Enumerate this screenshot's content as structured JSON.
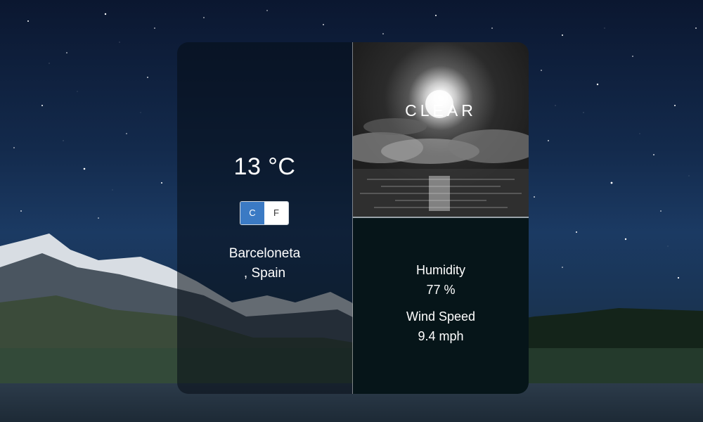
{
  "weather": {
    "temperature": "13 °C",
    "units": {
      "celsius_label": "C",
      "fahrenheit_label": "F",
      "selected": "C"
    },
    "location_city": "Barceloneta",
    "location_country": ", Spain",
    "condition": "CLEAR",
    "humidity_label": "Humidity",
    "humidity_value": "77 %",
    "wind_label": "Wind Speed",
    "wind_value": "9.4 mph"
  },
  "colors": {
    "toggle_active": "#3b7ac4",
    "stats_background": "#061519"
  },
  "icons": {
    "background": "night-sky-mountain-lake-scene",
    "condition_image": "moon-over-clouds-image"
  }
}
